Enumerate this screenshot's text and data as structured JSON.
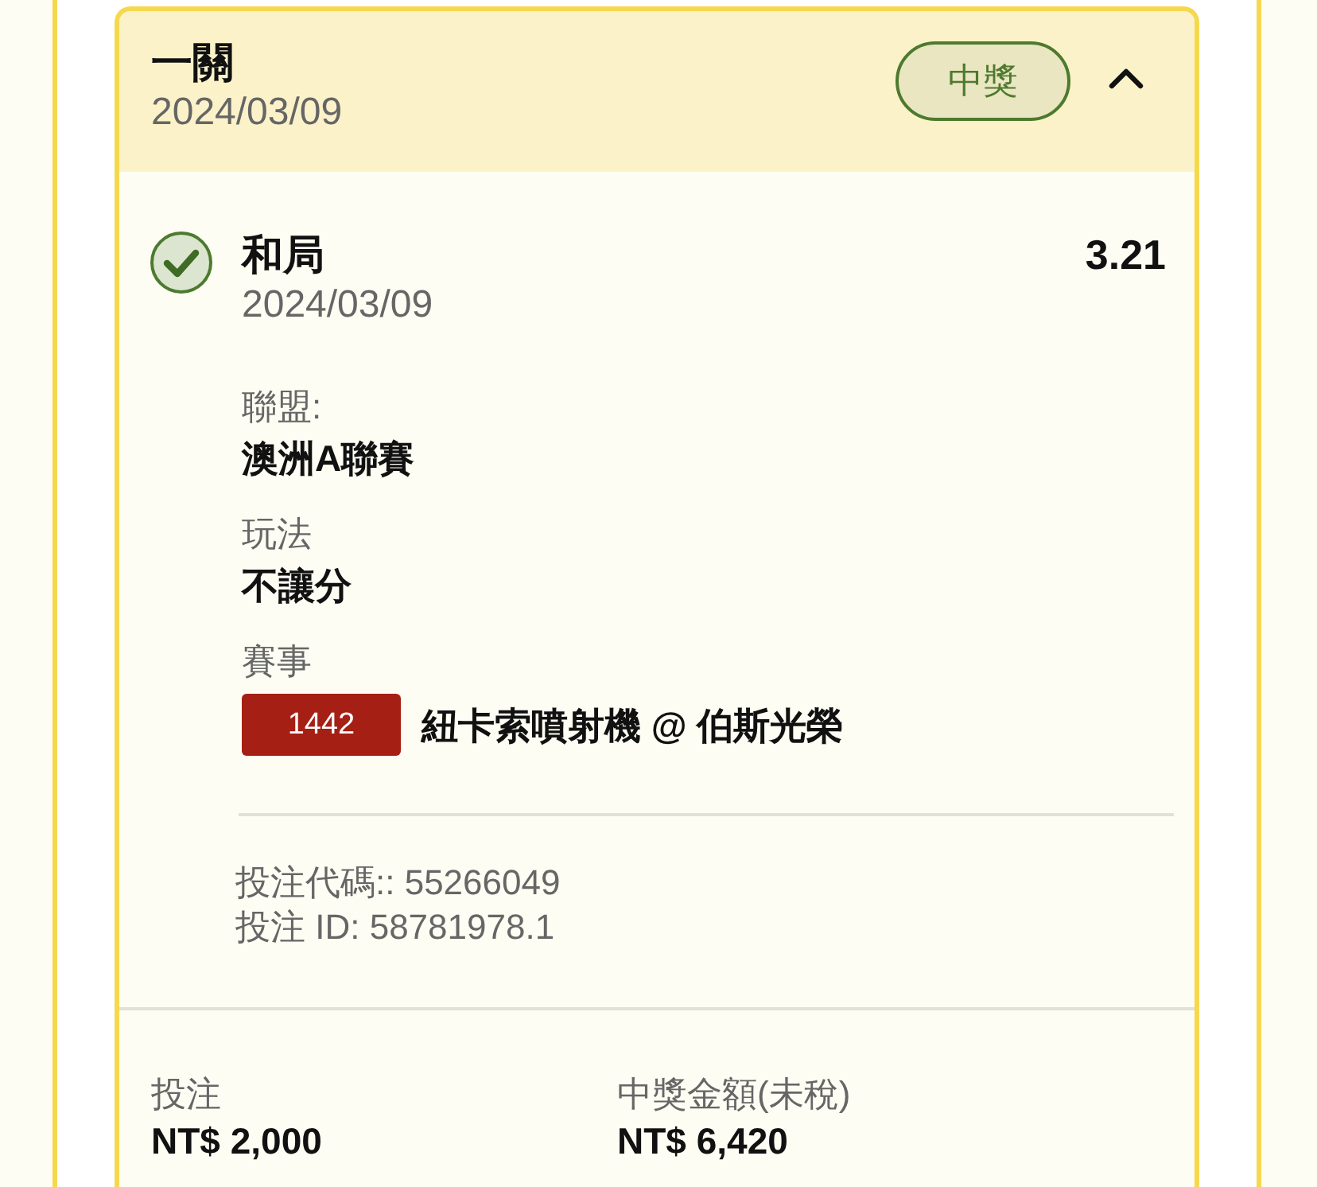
{
  "ticket": {
    "title": "一關",
    "date": "2024/03/09",
    "status": {
      "label": "中獎",
      "kind": "won"
    },
    "expanded": true,
    "selection": {
      "won": true,
      "name": "和局",
      "date": "2024/03/09",
      "odds": "3.21",
      "fields": [
        {
          "label": "聯盟:",
          "value": "澳洲A聯賽"
        },
        {
          "label": "玩法",
          "value": "不讓分"
        }
      ],
      "event": {
        "label": "賽事",
        "code": "1442",
        "name": "紐卡索噴射機 @ 伯斯光榮"
      },
      "bet_code": "投注代碼:: 55266049",
      "bet_id": "投注 ID: 58781978.1"
    },
    "amounts": [
      {
        "label": "投注",
        "value": "NT$ 2,000"
      },
      {
        "label": "中獎金額(未稅)",
        "value": "NT$ 6,420"
      }
    ]
  }
}
